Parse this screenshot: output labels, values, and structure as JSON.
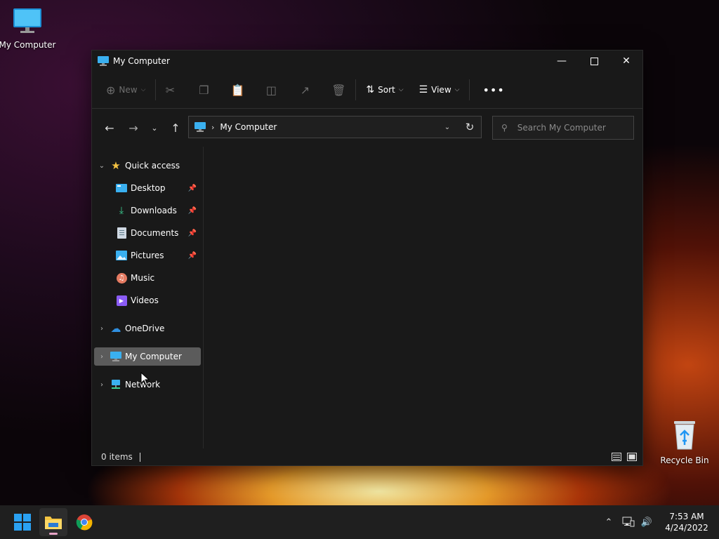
{
  "desktop": {
    "my_computer_label": "My Computer",
    "recycle_bin_label": "Recycle Bin"
  },
  "window": {
    "title": "My Computer",
    "toolbar": {
      "new_label": "New",
      "sort_label": "Sort",
      "view_label": "View"
    },
    "address": {
      "path": "My Computer"
    },
    "search": {
      "placeholder": "Search My Computer"
    },
    "sidebar": {
      "quick_access": "Quick access",
      "items": [
        "Desktop",
        "Downloads",
        "Documents",
        "Pictures",
        "Music",
        "Videos"
      ],
      "onedrive": "OneDrive",
      "my_computer": "My Computer",
      "network": "Network"
    },
    "status": {
      "items_count": "0 items"
    }
  },
  "taskbar": {
    "time": "7:53 AM",
    "date": "4/24/2022"
  },
  "colors": {
    "accent_blue": "#3ab0f0",
    "selected_bg": "#5b5b5b",
    "window_bg": "#191919",
    "taskbar_bg": "#1f1f1f"
  }
}
